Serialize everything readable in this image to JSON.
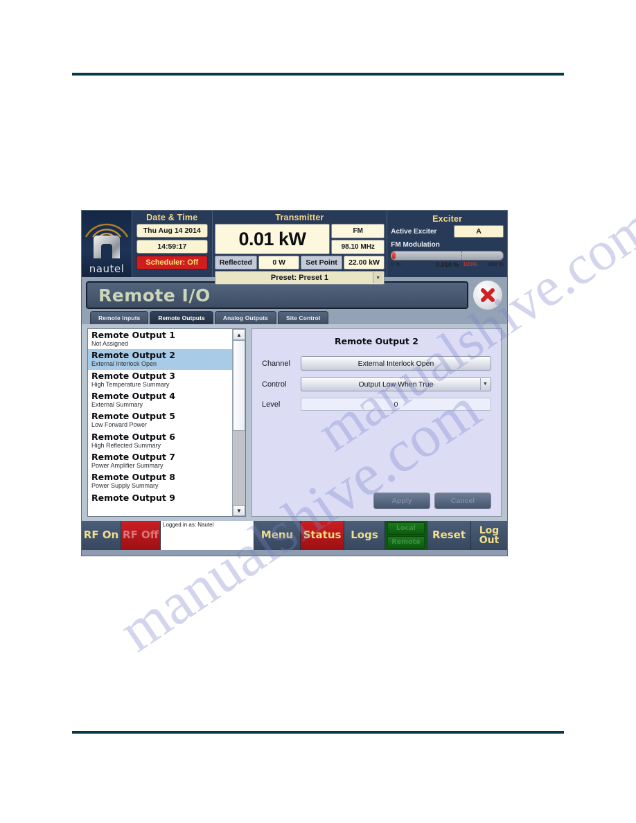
{
  "status_bar": {
    "logo_wordmark": "nautel",
    "date_time": {
      "header": "Date & Time",
      "date": "Thu Aug 14 2014",
      "time": "14:59:17",
      "scheduler": "Scheduler: Off"
    },
    "transmitter": {
      "header": "Transmitter",
      "forward_power": "0.01 kW",
      "mode": "FM",
      "frequency": "98.10 MHz",
      "reflected_label": "Reflected",
      "reflected_value": "0 W",
      "setpoint_label": "Set Point",
      "setpoint_value": "22.00 kW",
      "preset": "Preset: Preset 1"
    },
    "exciter": {
      "header": "Exciter",
      "active_exciter_label": "Active Exciter",
      "active_exciter_value": "A",
      "modulation_label": "FM Modulation",
      "scale_min": "0 %",
      "scale_value": "0.010 %",
      "scale_100": "100%",
      "scale_max": "160 %"
    }
  },
  "title_bar": {
    "title": "Remote I/O",
    "close_icon": "close-icon"
  },
  "tabs": [
    {
      "label": "Remote Inputs",
      "active": false
    },
    {
      "label": "Remote Outputs",
      "active": true
    },
    {
      "label": "Analog Outputs",
      "active": false
    },
    {
      "label": "Site Control",
      "active": false
    }
  ],
  "output_list": [
    {
      "title": "Remote Output 1",
      "subtitle": "Not Assigned",
      "selected": false
    },
    {
      "title": "Remote Output 2",
      "subtitle": "External Interlock Open",
      "selected": true
    },
    {
      "title": "Remote Output 3",
      "subtitle": "High Temperature Summary",
      "selected": false
    },
    {
      "title": "Remote Output 4",
      "subtitle": "External Summary",
      "selected": false
    },
    {
      "title": "Remote Output 5",
      "subtitle": "Low Forward Power",
      "selected": false
    },
    {
      "title": "Remote Output 6",
      "subtitle": "High Reflected Summary",
      "selected": false
    },
    {
      "title": "Remote Output 7",
      "subtitle": "Power Amplifier Summary",
      "selected": false
    },
    {
      "title": "Remote Output 8",
      "subtitle": "Power Supply Summary",
      "selected": false
    },
    {
      "title": "Remote Output 9",
      "subtitle": "",
      "selected": false
    }
  ],
  "scrollbar": {
    "up_icon": "▲",
    "down_icon": "▼"
  },
  "detail": {
    "title": "Remote Output 2",
    "channel_label": "Channel",
    "channel_value": "External Interlock Open",
    "control_label": "Control",
    "control_value": "Output Low When True",
    "level_label": "Level",
    "level_value": "0",
    "apply_label": "Apply",
    "cancel_label": "Cancel"
  },
  "toolbar": {
    "rf_on": "RF On",
    "rf_off": "RF Off",
    "logged_in": "Logged in as: Nautel",
    "menu": "Menu",
    "status": "Status",
    "logs": "Logs",
    "local": "Local",
    "remote": "Remote",
    "reset": "Reset",
    "log_out_line1": "Log",
    "log_out_line2": "Out"
  },
  "watermark": {
    "text1": "manualshive.com",
    "text2": "manualshive.com"
  },
  "colors": {
    "accent_yellow": "#f0e08a",
    "alarm_red": "#cc1f22",
    "panel_blue": "#273a57",
    "selection_blue": "#a8cbe8",
    "rule_teal": "#05394a"
  }
}
